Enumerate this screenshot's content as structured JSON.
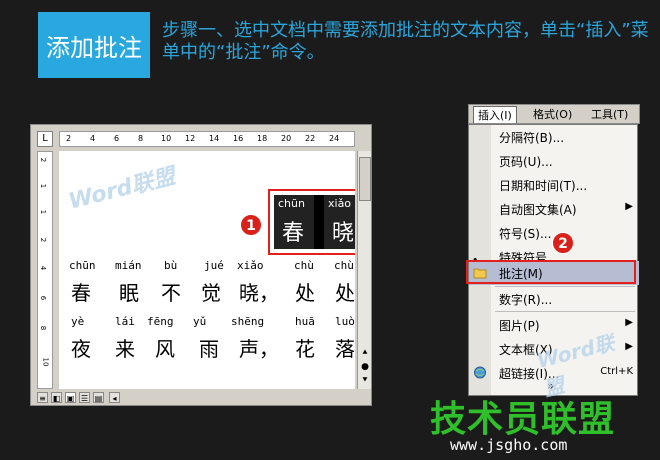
{
  "header": {
    "title": "添加批注",
    "instruction": "步骤一、选中文档中需要添加批注的文本内容，单击“插入”菜单中的“批注”命令。"
  },
  "document": {
    "corner": "L",
    "ruler_marks": [
      "2",
      "4",
      "6",
      "8",
      "10",
      "12",
      "14",
      "16",
      "18",
      "20",
      "22",
      "24"
    ],
    "vruler_marks": [
      "2",
      "1",
      "1",
      "2",
      "4",
      "6",
      "8",
      "10"
    ],
    "watermark": "Word联盟",
    "selection": {
      "pinyin": [
        "chūn",
        "xiǎo"
      ],
      "hanzi": [
        "春",
        "晓"
      ]
    },
    "line1": {
      "pinyin": [
        "chūn",
        "mián",
        "bù",
        "jué",
        "xiǎo",
        "chù",
        "chù"
      ],
      "hanzi": [
        "春",
        "眠",
        "不",
        "觉",
        "晓，",
        "处",
        "处"
      ]
    },
    "line2": {
      "pinyin": [
        "yè",
        "lái",
        "fēng",
        "yǔ",
        "shēng",
        "huā",
        "luò"
      ],
      "hanzi": [
        "夜",
        "来",
        "风",
        "雨",
        "声，",
        "花",
        "落"
      ]
    }
  },
  "badges": {
    "one": "1",
    "two": "2"
  },
  "menubar": {
    "items": [
      "插入(I)",
      "格式(O)",
      "工具(T)"
    ]
  },
  "menu": {
    "items": [
      {
        "label": "分隔符(B)...",
        "arrow": "",
        "shortcut": ""
      },
      {
        "label": "页码(U)...",
        "arrow": "",
        "shortcut": ""
      },
      {
        "label": "日期和时间(T)...",
        "arrow": "",
        "shortcut": ""
      },
      {
        "label": "自动图文集(A)",
        "arrow": "▶",
        "shortcut": ""
      },
      {
        "label": "符号(S)...",
        "arrow": "",
        "shortcut": ""
      },
      {
        "label": "特殊符号",
        "arrow": "",
        "shortcut": ""
      },
      {
        "label": "批注(M)",
        "arrow": "",
        "shortcut": ""
      },
      {
        "label": "数字(R)...",
        "arrow": "",
        "shortcut": ""
      },
      {
        "label": "图片(P)",
        "arrow": "▶",
        "shortcut": ""
      },
      {
        "label": "文本框(X)",
        "arrow": "▶",
        "shortcut": ""
      },
      {
        "label": "超链接(I)...",
        "arrow": "",
        "shortcut": "Ctrl+K"
      }
    ],
    "more": "»"
  },
  "logo": {
    "name": "技术员联盟",
    "url": "www.jsgho.com"
  },
  "colors": {
    "accent_blue": "#29a7df",
    "highlight_red": "#e2211c",
    "logo_green": "#2fbf2a"
  }
}
